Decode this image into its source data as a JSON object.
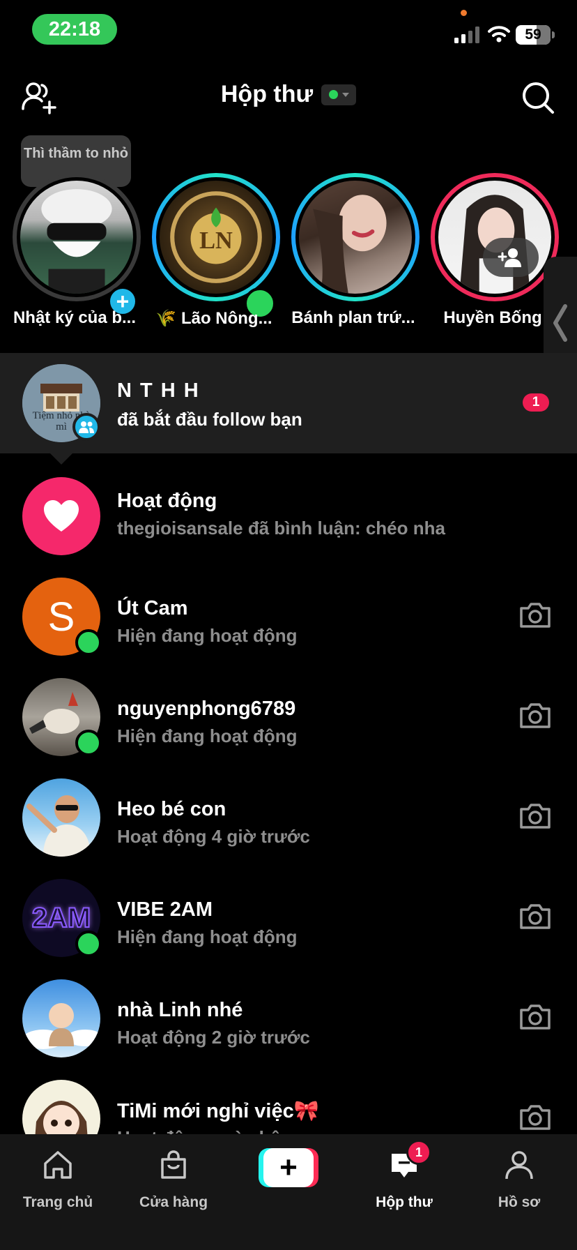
{
  "status_bar": {
    "time": "22:18",
    "battery": "59",
    "colors": {
      "time_pill": "#34c759"
    }
  },
  "header": {
    "title": "Hộp thư",
    "online_status_color": "#2bd45b"
  },
  "tooltip": "Thì thầm to nhỏ",
  "stories": [
    {
      "name": "Nhật ký của b...",
      "ring": "grey"
    },
    {
      "name": "🌾 Lão Nông...",
      "ring": "teal"
    },
    {
      "name": "Bánh plan trứ...",
      "ring": "teal"
    },
    {
      "name": "Huyền Bống",
      "ring": "pink"
    }
  ],
  "highlight_row": {
    "name": "N T H H",
    "subtitle": "đã bắt đầu follow bạn",
    "badge": "1",
    "avatar_text": "Tiệm nhỏ nhà mì"
  },
  "activity_row": {
    "title": "Hoạt động",
    "subtitle": "thegioisansale đã bình luận: chéo nha"
  },
  "conversations": [
    {
      "name": "Út Cam",
      "status": "Hiện đang hoạt động",
      "online": true,
      "avatar_letter": "S"
    },
    {
      "name": "nguyenphong6789",
      "status": "Hiện đang hoạt động",
      "online": true
    },
    {
      "name": "Heo bé con",
      "status": "Hoạt động 4 giờ trước",
      "online": false
    },
    {
      "name": "VIBE 2AM",
      "status": "Hiện đang hoạt động",
      "online": true,
      "avatar_text": "2AM"
    },
    {
      "name": "nhà Linh nhé",
      "status": "Hoạt động 2 giờ trước",
      "online": false
    },
    {
      "name": "TiMi mới nghỉ việc🎀",
      "status": "Hoạt động ngày hôm nay",
      "online": false
    }
  ],
  "bottom_nav": {
    "home": "Trang chủ",
    "shop": "Cửa hàng",
    "create": "+",
    "inbox": "Hộp thư",
    "inbox_badge": "1",
    "profile": "Hồ sơ"
  }
}
